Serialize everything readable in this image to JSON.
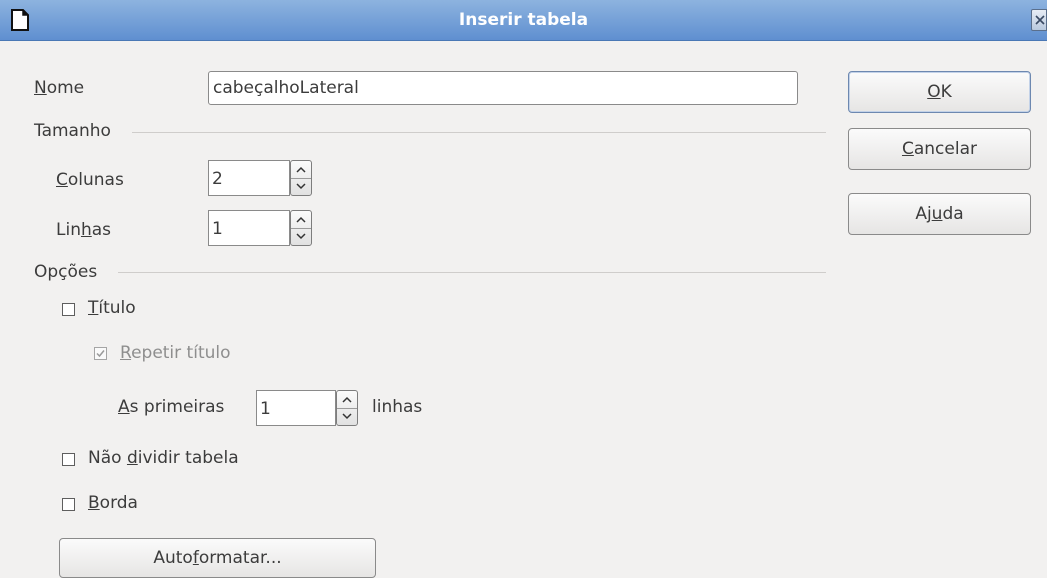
{
  "window": {
    "title": "Inserir tabela"
  },
  "name_field": {
    "label": "Nome",
    "value": "cabeçalhoLateral"
  },
  "size_section": {
    "heading": "Tamanho",
    "columns": {
      "label": "Colunas",
      "value": "2"
    },
    "rows": {
      "label": "Linhas",
      "value": "1"
    }
  },
  "options_section": {
    "heading": "Opções",
    "title_option": {
      "label": "Título",
      "checked": false
    },
    "repeat_title": {
      "label": "Repetir título",
      "checked": true,
      "enabled": false
    },
    "first_rows": {
      "prefix": "As primeiras",
      "value": "1",
      "suffix": "linhas"
    },
    "no_split": {
      "label": "Não dividir tabela",
      "checked": false
    },
    "border": {
      "label": "Borda",
      "checked": false
    },
    "autoformat_label": "Autoformatar..."
  },
  "buttons": {
    "ok": "OK",
    "cancel": "Cancelar",
    "help": "Ajuda"
  },
  "icons": {
    "app": "document-icon",
    "close": "close-icon",
    "spin_up": "chevron-up-icon",
    "spin_down": "chevron-down-icon",
    "check": "checkmark-icon"
  }
}
